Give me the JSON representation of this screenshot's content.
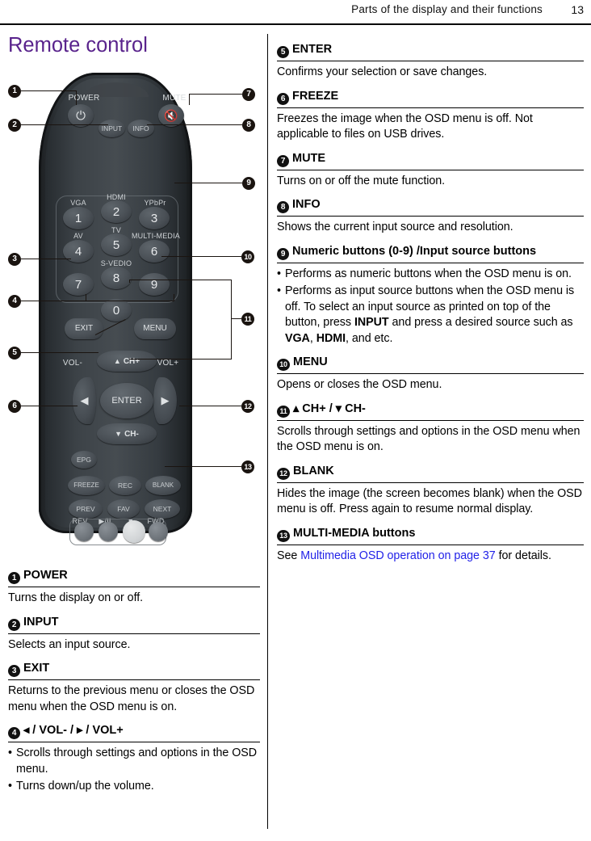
{
  "header": {
    "title": "Parts of the display and their functions",
    "page_number": "13"
  },
  "left_column": {
    "section_title": "Remote control"
  },
  "remote": {
    "alt": "remote-control-diagram",
    "keys": {
      "power_label": "POWER",
      "mute_label": "MUTE",
      "input_label": "INPUT",
      "info_label": "INFO",
      "exit_label": "EXIT",
      "menu_label": "MENU",
      "enter_label": "ENTER",
      "ch_up_label": "CH+",
      "ch_down_label": "CH-",
      "vol_down_label": "VOL-",
      "vol_up_label": "VOL+",
      "epg_label": "EPG",
      "freeze_label": "FREEZE",
      "rec_label": "REC",
      "blank_label": "BLANK",
      "prev_label": "PREV",
      "fav_label": "FAV",
      "next_label": "NEXT",
      "rev_label": "REV",
      "playpause_label": "▶/II",
      "stop_label": "■",
      "fwd_label": "FWD"
    },
    "numpad": [
      {
        "digit": "1",
        "source": "VGA"
      },
      {
        "digit": "2",
        "source": "HDMI"
      },
      {
        "digit": "3",
        "source": "YPbPr"
      },
      {
        "digit": "4",
        "source": "AV"
      },
      {
        "digit": "5",
        "source": "TV"
      },
      {
        "digit": "6",
        "source": "MULTI-MEDIA"
      },
      {
        "digit": "7",
        "source": ""
      },
      {
        "digit": "8",
        "source": "S-VEDIO"
      },
      {
        "digit": "9",
        "source": ""
      },
      {
        "digit": "0",
        "source": ""
      }
    ],
    "callouts": [
      "1",
      "2",
      "3",
      "4",
      "5",
      "6",
      "7",
      "8",
      "9",
      "10",
      "11",
      "12",
      "13"
    ]
  },
  "entries": {
    "e1": {
      "num": "1",
      "title": "POWER",
      "body": "Turns the display on or off."
    },
    "e2": {
      "num": "2",
      "title": "INPUT",
      "body": "Selects an input source."
    },
    "e3": {
      "num": "3",
      "title": "EXIT",
      "body": "Returns to the previous menu or closes the OSD menu when the OSD menu is on."
    },
    "e4": {
      "num": "4",
      "title": "◂ / VOL- / ▸ / VOL+",
      "bullets": [
        "Scrolls through settings and options in the OSD menu.",
        "Turns down/up the volume."
      ]
    },
    "e5": {
      "num": "5",
      "title": "ENTER",
      "body": "Confirms your selection or save changes."
    },
    "e6": {
      "num": "6",
      "title": "FREEZE",
      "body": "Freezes the image when the OSD menu is off. Not applicable to files on USB drives."
    },
    "e7": {
      "num": "7",
      "title": "MUTE",
      "body": "Turns on or off the mute function."
    },
    "e8": {
      "num": "8",
      "title": "INFO",
      "body": "Shows the current input source and resolution."
    },
    "e9": {
      "num": "9",
      "title": "Numeric buttons (0-9) /Input source buttons",
      "bullets": [
        "Performs as numeric buttons when the OSD menu is on."
      ],
      "bullet2_pre": "Performs as input source buttons when the OSD menu is off. To select an input source as printed on top of the button, press ",
      "bullet2_b1": "INPUT",
      "bullet2_mid": " and press a desired source such as ",
      "bullet2_b2": "VGA",
      "bullet2_mid2": ", ",
      "bullet2_b3": "HDMI",
      "bullet2_post": ", and etc."
    },
    "e10": {
      "num": "10",
      "title": "MENU",
      "body": "Opens or closes the OSD menu."
    },
    "e11": {
      "num": "11",
      "title": "▴ CH+ / ▾ CH-",
      "body": "Scrolls through settings and options in the OSD menu when the OSD menu is on."
    },
    "e12": {
      "num": "12",
      "title": "BLANK",
      "body": "Hides the image (the screen becomes blank) when the OSD menu is off. Press again to resume normal display."
    },
    "e13": {
      "num": "13",
      "title": "MULTI-MEDIA buttons",
      "body_pre": "See ",
      "body_link": "Multimedia OSD operation on page 37",
      "body_post": " for details."
    }
  },
  "colors": {
    "heading_purple": "#59238C",
    "link_blue": "#2222E8",
    "rule_black": "#000000"
  }
}
